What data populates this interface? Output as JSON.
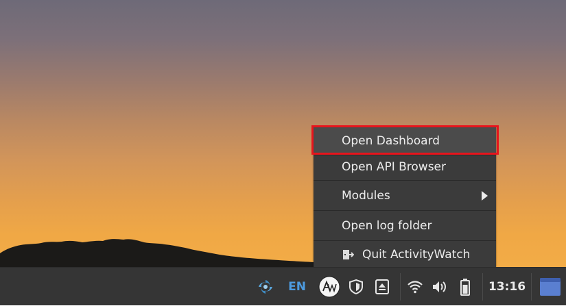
{
  "context_menu": {
    "items": [
      {
        "label": "Open Dashboard",
        "highlighted": true
      },
      {
        "label": "Open API Browser"
      },
      {
        "label": "Modules",
        "has_submenu": true
      },
      {
        "label": "Open log folder"
      },
      {
        "label": "Quit ActivityWatch",
        "icon": "exit-icon"
      }
    ],
    "highlight_color": "#e8141c"
  },
  "taskbar": {
    "tray_icons": [
      "swirl-app-icon",
      "activitywatch-icon",
      "shield-icon",
      "eject-icon",
      "wifi-icon",
      "volume-icon",
      "battery-icon",
      "window-switcher-icon"
    ],
    "language": "EN",
    "clock": "13:16"
  },
  "colors": {
    "taskbar_bg": "#353535",
    "menu_bg": "#3b3b3b",
    "language_text": "#4d9be0",
    "switcher": "#5a7fd0"
  }
}
